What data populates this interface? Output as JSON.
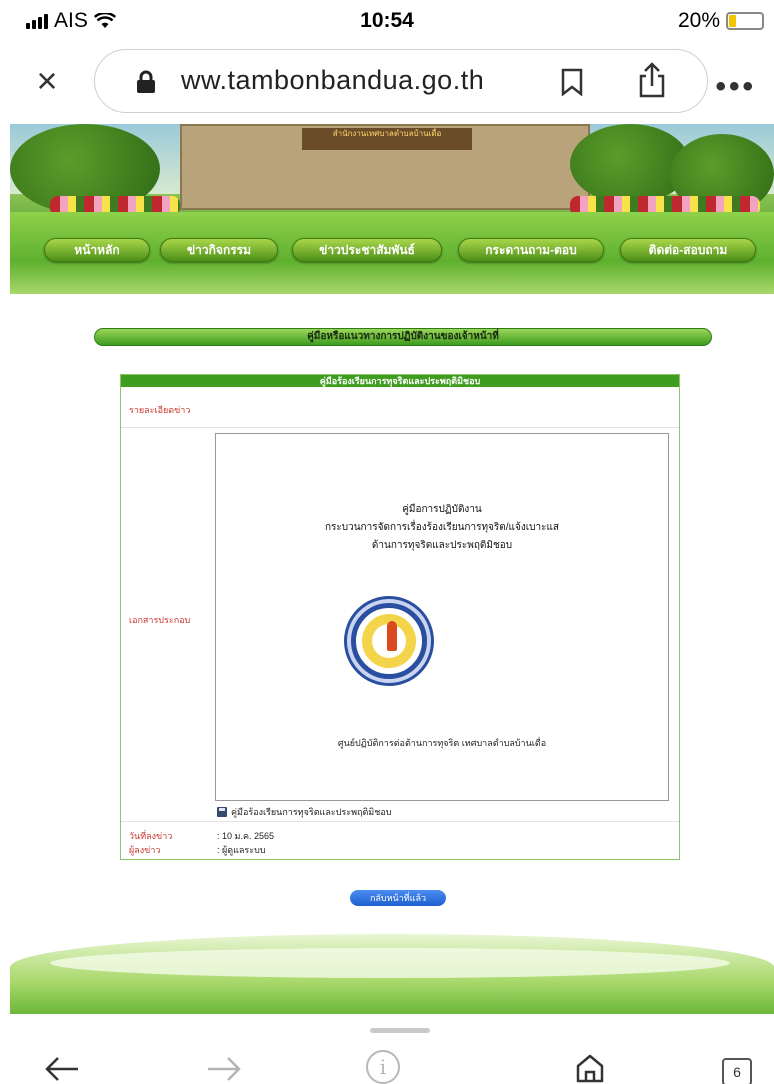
{
  "status_bar": {
    "carrier": "AIS",
    "time": "10:54",
    "battery": "20%",
    "battery_level_percent": 20
  },
  "browser": {
    "url": "ww.tambonbandua.go.th",
    "icons": {
      "close": "close-icon",
      "lock": "lock-icon",
      "bookmark": "bookmark-icon",
      "share": "share-icon",
      "more": "more-icon"
    }
  },
  "site": {
    "building_sign": "สำนักงานเทศบาลตำบลบ้านเดื่อ",
    "nav": [
      {
        "label": "หน้าหลัก"
      },
      {
        "label": "ข่าวกิจกรรม"
      },
      {
        "label": "ข่าวประชาสัมพันธ์"
      },
      {
        "label": "กระดานถาม-ตอบ"
      },
      {
        "label": "ติดต่อ-สอบถาม"
      }
    ],
    "section_title": "คู่มือหรือแนวทางการปฏิบัติงานของเจ้าหน้าที่"
  },
  "news": {
    "table_title": "คู่มือร้องเรียนการทุจริตและประพฤติมิชอบ",
    "detail_label": "รายละเอียดข่าว",
    "attachment_label": "เอกสารประกอบ",
    "document": {
      "line1": "คู่มือการปฏิบัติงาน",
      "line2": "กระบวนการจัดการเรื่องร้องเรียนการทุจริต/แจ้งเบาะแส",
      "line3": "ด้านการทุจริตและประพฤติมิชอบ",
      "footer": "ศูนย์ปฏิบัติการต่อต้านการทุจริต เทศบาลตำบลบ้านเดื่อ"
    },
    "attachment_file": "คู่มือร้องเรียนการทุจริตและประพฤติมิชอบ",
    "date_label": "วันที่ลงข่าว",
    "date_value": ": 10 ม.ค. 2565",
    "author_label": "ผู้ลงข่าว",
    "author_value": ": ผู้ดูแลระบบ",
    "back_button": "กลับหน้าที่แล้ว"
  },
  "toolbar": {
    "tabs_count": "6"
  }
}
